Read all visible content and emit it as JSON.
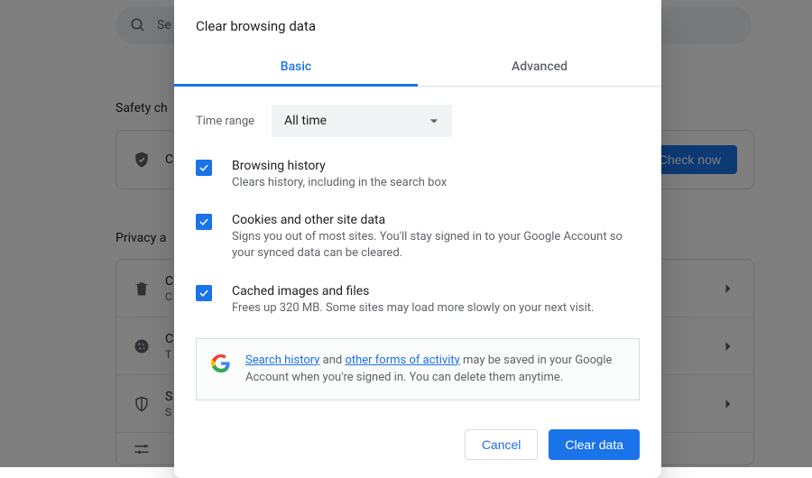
{
  "search": {
    "placeholder": "Se"
  },
  "sections": {
    "safety": "Safety ch",
    "privacy": "Privacy a"
  },
  "check_btn": "Check now",
  "bg_rows": {
    "r1": "C",
    "r1_sub": "C",
    "r2": "C",
    "r2_sub": "T",
    "r3": "S",
    "r3_sub": "S"
  },
  "dialog": {
    "title": "Clear browsing data",
    "tabs": {
      "basic": "Basic",
      "advanced": "Advanced"
    },
    "time_label": "Time range",
    "time_value": "All time",
    "opts": {
      "history": {
        "title": "Browsing history",
        "sub": "Clears history, including in the search box"
      },
      "cookies": {
        "title": "Cookies and other site data",
        "sub": "Signs you out of most sites. You'll stay signed in to your Google Account so your synced data can be cleared."
      },
      "cache": {
        "title": "Cached images and files",
        "sub": "Frees up 320 MB. Some sites may load more slowly on your next visit."
      }
    },
    "info": {
      "link1": "Search history",
      "mid": " and ",
      "link2": "other forms of activity",
      "rest": " may be saved in your Google Account when you're signed in. You can delete them anytime."
    },
    "cancel": "Cancel",
    "clear": "Clear data"
  }
}
